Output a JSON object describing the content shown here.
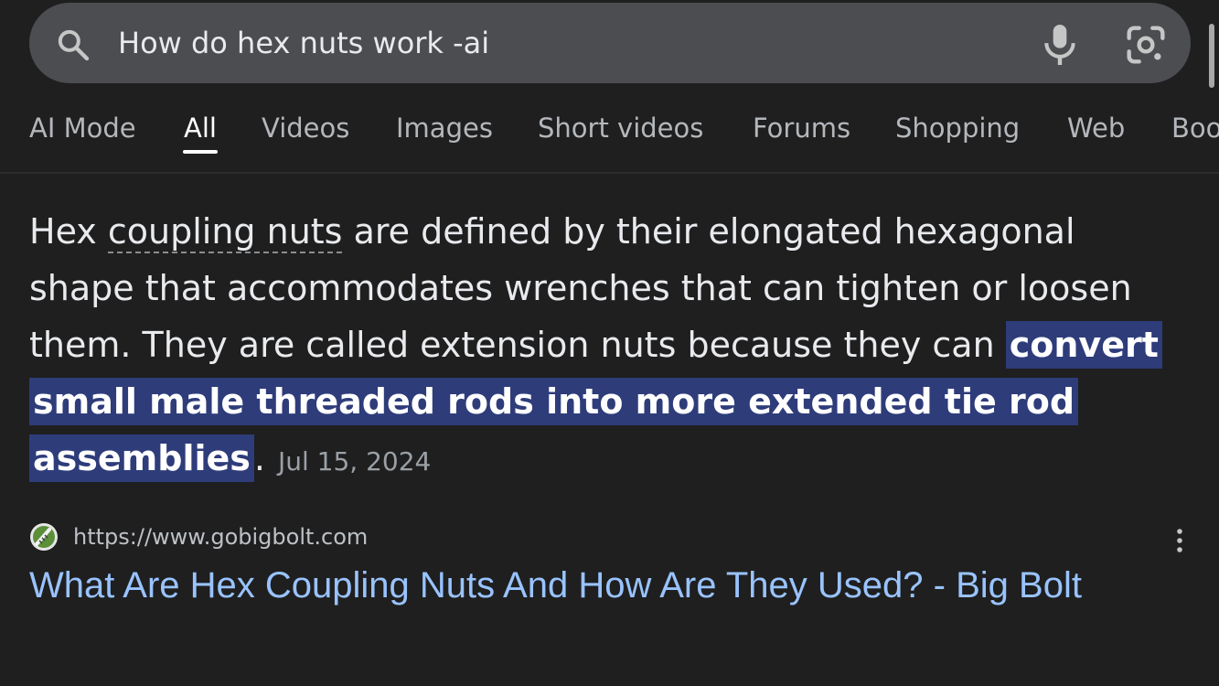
{
  "search": {
    "query": "How do hex nuts work -ai",
    "icons": [
      "search-icon",
      "microphone-icon",
      "google-lens-icon"
    ]
  },
  "tabs": [
    {
      "label": "AI Mode",
      "active": false
    },
    {
      "label": "All",
      "active": true
    },
    {
      "label": "Videos",
      "active": false
    },
    {
      "label": "Images",
      "active": false
    },
    {
      "label": "Short videos",
      "active": false
    },
    {
      "label": "Forums",
      "active": false
    },
    {
      "label": "Shopping",
      "active": false
    },
    {
      "label": "Web",
      "active": false
    },
    {
      "label": "Boo",
      "active": false
    }
  ],
  "snippet": {
    "text_start": "Hex ",
    "dotted_term": "coupling nuts",
    "text_middle": " are defined by their elongated hexagonal shape that accommodates wrenches that can tighten or loosen them. They are called extension nuts because they can ",
    "highlighted": "convert small male threaded rods into more extended tie rod assemblies",
    "text_end": ".",
    "date": "Jul 15, 2024"
  },
  "result": {
    "url": "https://www.gobigbolt.com",
    "title": "What Are Hex Coupling Nuts And How Are They Used? - Big Bolt",
    "favicon_icon": "bolt-favicon-icon",
    "menu_icon": "more-vert-icon"
  },
  "colors": {
    "background": "#1f1f1f",
    "search_bar": "#4b4d50",
    "highlight": "#2e3c7a",
    "link": "#99c3ff"
  }
}
